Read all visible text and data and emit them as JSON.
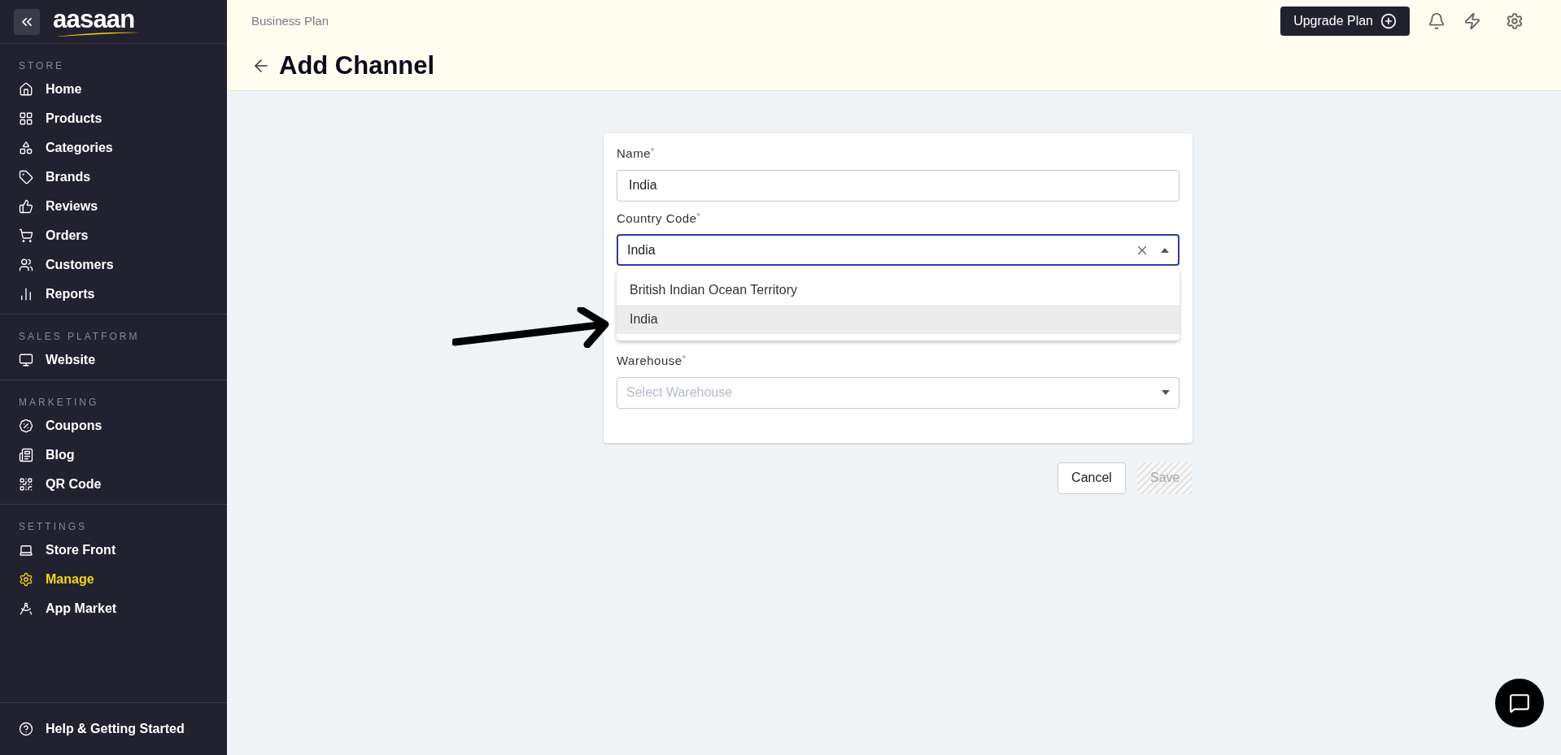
{
  "logo": "aasaan",
  "sidebar": {
    "sections": [
      {
        "title": "STORE",
        "items": [
          {
            "label": "Home",
            "selected": false
          },
          {
            "label": "Products",
            "selected": false
          },
          {
            "label": "Categories",
            "selected": false
          },
          {
            "label": "Brands",
            "selected": false
          },
          {
            "label": "Reviews",
            "selected": false
          },
          {
            "label": "Orders",
            "selected": false
          },
          {
            "label": "Customers",
            "selected": false
          },
          {
            "label": "Reports",
            "selected": false
          }
        ]
      },
      {
        "title": "SALES PLATFORM",
        "items": [
          {
            "label": "Website",
            "selected": false
          }
        ]
      },
      {
        "title": "MARKETING",
        "items": [
          {
            "label": "Coupons",
            "selected": false
          },
          {
            "label": "Blog",
            "selected": false
          },
          {
            "label": "QR Code",
            "selected": false
          }
        ]
      },
      {
        "title": "SETTINGS",
        "items": [
          {
            "label": "Store Front",
            "selected": false
          },
          {
            "label": "Manage",
            "selected": true
          },
          {
            "label": "App Market",
            "selected": false
          }
        ]
      }
    ],
    "footer": {
      "label": "Help & Getting Started"
    }
  },
  "header": {
    "plan": "Business Plan",
    "title": "Add Channel",
    "upgrade_button": "Upgrade Plan"
  },
  "form": {
    "fields": [
      {
        "kind": "text",
        "label": "Name",
        "required_mark": "*",
        "value": "India"
      },
      {
        "kind": "select",
        "label": "Country Code",
        "required_mark": "*",
        "value": "India",
        "focused": true,
        "expanded": true,
        "options": [
          {
            "label": "British Indian Ocean Territory",
            "selected": false
          },
          {
            "label": "India",
            "selected": true
          }
        ]
      },
      {
        "kind": "select",
        "label": "Warehouse",
        "required_mark": "*",
        "placeholder": "Select Warehouse",
        "focused": false,
        "expanded": false
      }
    ]
  },
  "actions": [
    {
      "label": "Cancel",
      "disabled": false
    },
    {
      "label": "Save",
      "disabled": true
    }
  ]
}
